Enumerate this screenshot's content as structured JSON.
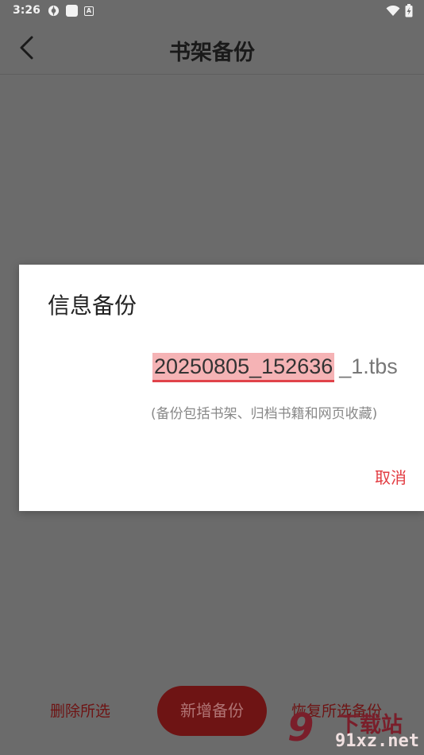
{
  "status_bar": {
    "time": "3:26",
    "left_icons": [
      "radar-icon",
      "square-icon",
      "a-box-icon"
    ],
    "right_icons": [
      "wifi-icon",
      "battery-charging-icon"
    ]
  },
  "app_bar": {
    "title": "书架备份",
    "back_icon": "chevron-left-icon"
  },
  "dialog": {
    "title": "信息备份",
    "filename_value": "20250805_152636",
    "filename_suffix": "_1.tbs",
    "hint": "(备份包括书架、归档书籍和网页收藏)",
    "cancel_label": "取消"
  },
  "bottom_bar": {
    "delete_label": "删除所选",
    "add_label": "新增备份",
    "restore_label": "恢复所选备份"
  },
  "watermark": {
    "logo": "9",
    "cn_text": "下载站",
    "site": "91xz.net"
  },
  "colors": {
    "overlay_bg": "#6b6b6b",
    "accent_red": "#e23b41",
    "dark_red": "#6e1414",
    "highlight": "#f5b3b5"
  }
}
